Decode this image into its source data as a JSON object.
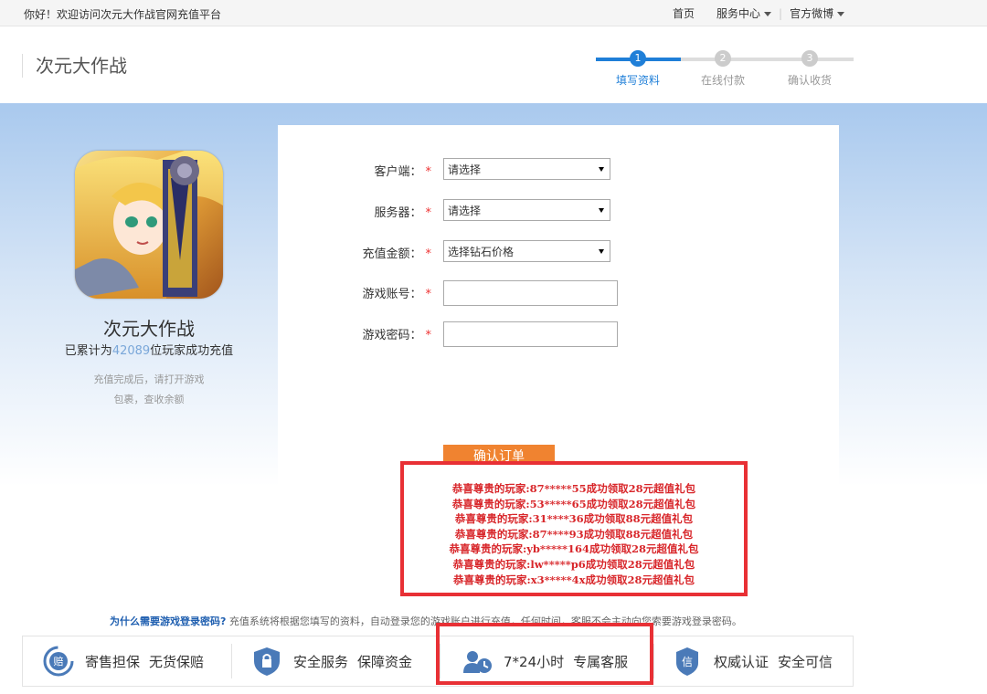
{
  "topbar": {
    "welcome": "你好！欢迎访问次元大作战官网充值平台",
    "home": "首页",
    "service": "服务中心",
    "weibo": "官方微博"
  },
  "header": {
    "brand": "次元大作战",
    "steps": [
      {
        "num": "1",
        "label": "填写资料",
        "active": true
      },
      {
        "num": "2",
        "label": "在线付款",
        "active": false
      },
      {
        "num": "3",
        "label": "确认收货",
        "active": false
      }
    ]
  },
  "game": {
    "title": "次元大作战",
    "count_prefix": "已累计为",
    "count_num": "42089",
    "count_suffix": "位玩家成功充值",
    "hint1": "充值完成后，请打开游戏",
    "hint2": "包裹，查收余额"
  },
  "form": {
    "client_label": "客户端：",
    "client_value": "请选择",
    "server_label": "服务器：",
    "server_value": "请选择",
    "amount_label": "充值金额：",
    "amount_value": "选择钻石价格",
    "account_label": "游戏账号：",
    "password_label": "游戏密码：",
    "required_mark": "*",
    "confirm": "确认订单"
  },
  "promo": {
    "lines": [
      "恭喜尊贵的玩家:87*****55成功领取28元超值礼包",
      "恭喜尊贵的玩家:53*****65成功领取28元超值礼包",
      "恭喜尊贵的玩家:31****36成功领取88元超值礼包",
      "恭喜尊贵的玩家:87****93成功领取88元超值礼包",
      "恭喜尊贵的玩家:yb*****164成功领取28元超值礼包",
      "恭喜尊贵的玩家:lw*****p6成功领取28元超值礼包",
      "恭喜尊贵的玩家:x3*****4x成功领取28元超值礼包"
    ]
  },
  "why": {
    "question": "为什么需要游戏登录密码?",
    "answer": "充值系统将根据您填写的资料，自动登录您的游戏账户进行充值，任何时间，客服不会主动向您索要游戏登录密码。"
  },
  "features": [
    {
      "icon": "guarantee-icon",
      "a": "寄售担保",
      "b": "无货保赔"
    },
    {
      "icon": "lock-icon",
      "a": "安全服务",
      "b": "保障资金"
    },
    {
      "icon": "customer-service-icon",
      "a": "7*24小时",
      "b": "专属客服"
    },
    {
      "icon": "trust-icon",
      "a": "权威认证",
      "b": "安全可信"
    }
  ],
  "colors": {
    "accent": "#1f7fd8",
    "confirm": "#f08330",
    "highlight": "#e83035",
    "promo_text": "#d8262a"
  }
}
